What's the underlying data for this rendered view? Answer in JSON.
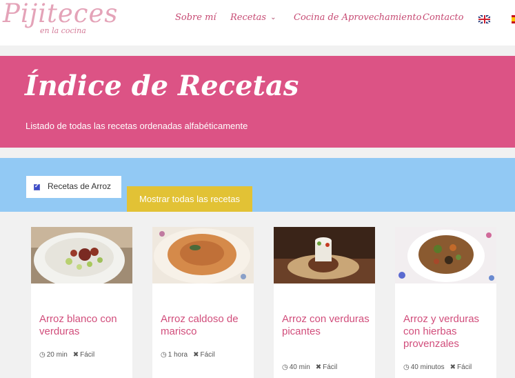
{
  "header": {
    "logo_main": "Pijiteces",
    "logo_sub": "en la cocina",
    "nav": [
      {
        "label": "Sobre mí"
      },
      {
        "label": "Recetas"
      },
      {
        "label": "Cocina de Aprovechamiento"
      },
      {
        "label": "Contacto"
      }
    ],
    "flags": [
      "uk-flag-icon",
      "es-flag-icon"
    ]
  },
  "hero": {
    "title": "Índice de Recetas",
    "subtitle": "Listado de todas las recetas ordenadas alfabéticamente"
  },
  "filter": {
    "checkbox_label": "Recetas de Arroz",
    "checked": true,
    "show_all_button": "Mostrar todas las recetas"
  },
  "recipes": [
    {
      "title": "Arroz blanco con verduras",
      "time": "20 min",
      "difficulty": "Fácil"
    },
    {
      "title": "Arroz caldoso de marisco",
      "time": "1 hora",
      "difficulty": "Fácil"
    },
    {
      "title": "Arroz con verduras picantes",
      "time": "40 min",
      "difficulty": "Fácil"
    },
    {
      "title": "Arroz y verduras con hierbas provenzales",
      "time": "40 minutos",
      "difficulty": "Fácil"
    }
  ],
  "colors": {
    "brand_pink": "#dc5385",
    "link_pink": "#d14d7b",
    "filter_blue": "#92c9f4",
    "button_yellow": "#e2c235"
  }
}
